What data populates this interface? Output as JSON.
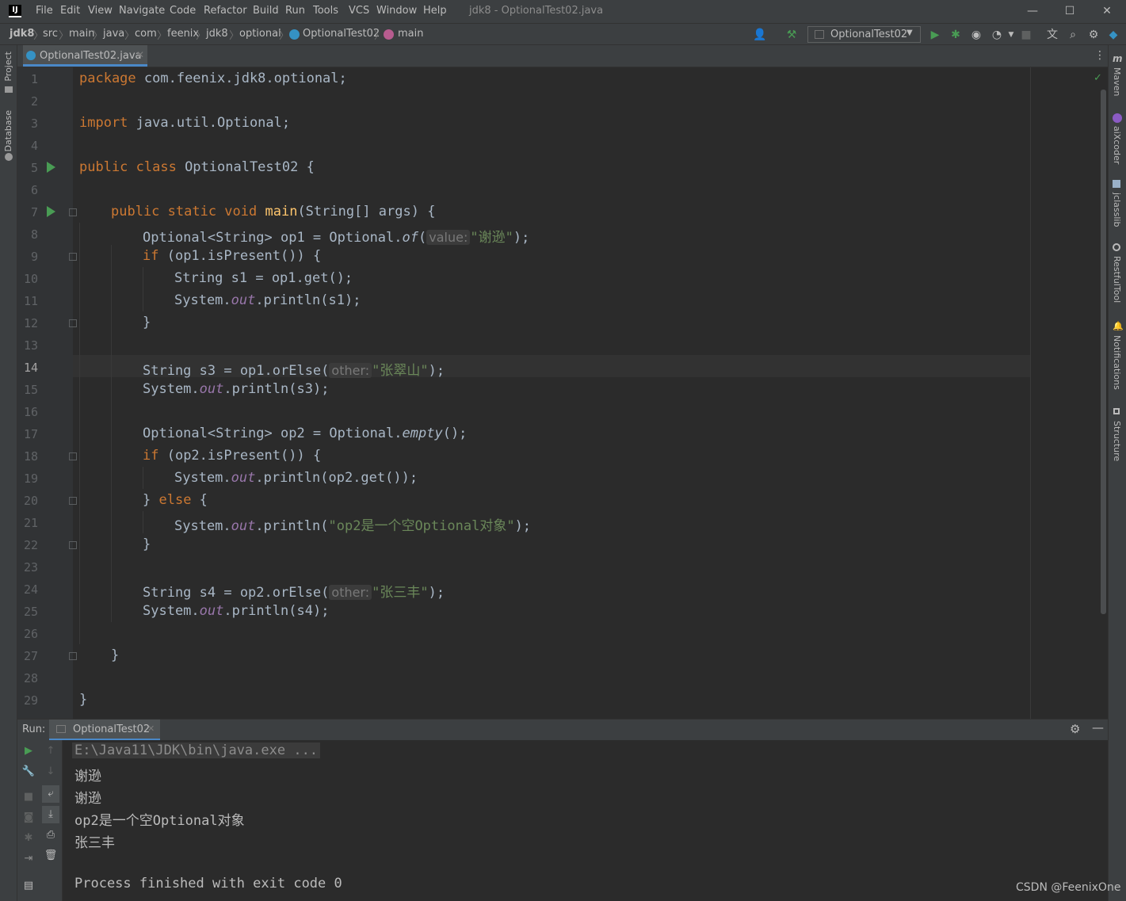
{
  "app": {
    "window_title": "jdk8 - OptionalTest02.java",
    "logo_text": "IJ"
  },
  "menu": [
    "File",
    "Edit",
    "View",
    "Navigate",
    "Code",
    "Refactor",
    "Build",
    "Run",
    "Tools",
    "VCS",
    "Window",
    "Help"
  ],
  "window_controls": {
    "minimize": "—",
    "maximize": "☐",
    "close": "✕"
  },
  "breadcrumb": [
    "jdk8",
    "src",
    "main",
    "java",
    "com",
    "feenix",
    "jdk8",
    "optional",
    "OptionalTest02",
    "main"
  ],
  "toolbar": {
    "run_config": "OptionalTest02",
    "icons": [
      "user-icon",
      "build-hammer-icon",
      "run-icon",
      "debug-icon",
      "coverage-icon",
      "profile-icon",
      "stop-icon",
      "translate-icon",
      "search-icon",
      "settings-icon",
      "plugin-icon"
    ]
  },
  "left_stripe": [
    "Project",
    "Database"
  ],
  "right_stripe": [
    "Maven",
    "aiXcoder",
    "jclasslib",
    "RestfulTool",
    "Notifications",
    "Structure"
  ],
  "editor": {
    "tab": "OptionalTest02.java",
    "current_line": 14,
    "line_numbers": [
      "1",
      "2",
      "3",
      "4",
      "5",
      "6",
      "7",
      "8",
      "9",
      "10",
      "11",
      "12",
      "13",
      "14",
      "15",
      "16",
      "17",
      "18",
      "19",
      "20",
      "21",
      "22",
      "23",
      "24",
      "25",
      "26",
      "27",
      "28",
      "29"
    ],
    "code": {
      "l1": [
        "package",
        " com.feenix.jdk8.optional;"
      ],
      "l3": [
        "import",
        " java.util.Optional;"
      ],
      "l5": [
        "public class",
        " OptionalTest02 {"
      ],
      "l7": [
        "public static void",
        "main",
        "(String[] args) {"
      ],
      "l8": [
        "Optional<String> op1 = Optional.",
        "of",
        "(",
        "value:",
        "\"谢逊\"",
        ");"
      ],
      "l9": [
        "if",
        " (op1.isPresent()) {"
      ],
      "l10": [
        "String s1 = op1.get();"
      ],
      "l11": [
        "System.",
        "out",
        ".println(s1);"
      ],
      "l12": [
        "}"
      ],
      "l14": [
        "String s3 = op1.orElse(",
        "other:",
        "\"张翠山\"",
        ");"
      ],
      "l15": [
        "System.",
        "out",
        ".println(s3);"
      ],
      "l17": [
        "Optional<String> op2 = Optional.",
        "empty",
        "();"
      ],
      "l18": [
        "if",
        " (op2.isPresent()) {"
      ],
      "l19": [
        "System.",
        "out",
        ".println(op2.get());"
      ],
      "l20": [
        "} ",
        "else",
        " {"
      ],
      "l21": [
        "System.",
        "out",
        ".println(",
        "\"op2是一个空Optional对象\"",
        ");"
      ],
      "l22": [
        "}"
      ],
      "l24": [
        "String s4 = op2.orElse(",
        "other:",
        "\"张三丰\"",
        ");"
      ],
      "l25": [
        "System.",
        "out",
        ".println(s4);"
      ],
      "l27": [
        "}"
      ],
      "l29": [
        "}"
      ]
    }
  },
  "run_panel": {
    "label": "Run:",
    "tab": "OptionalTest02",
    "console": [
      "E:\\Java11\\JDK\\bin\\java.exe ...",
      "谢逊",
      "谢逊",
      "op2是一个空Optional对象",
      "张三丰",
      "",
      "Process finished with exit code 0"
    ]
  },
  "watermark": "CSDN @FeenixOne",
  "colors": {
    "keyword": "#cc7832",
    "string": "#6a8759",
    "field": "#9876aa",
    "method": "#ffc66d",
    "text": "#a9b7c6",
    "run_green": "#499c54"
  }
}
